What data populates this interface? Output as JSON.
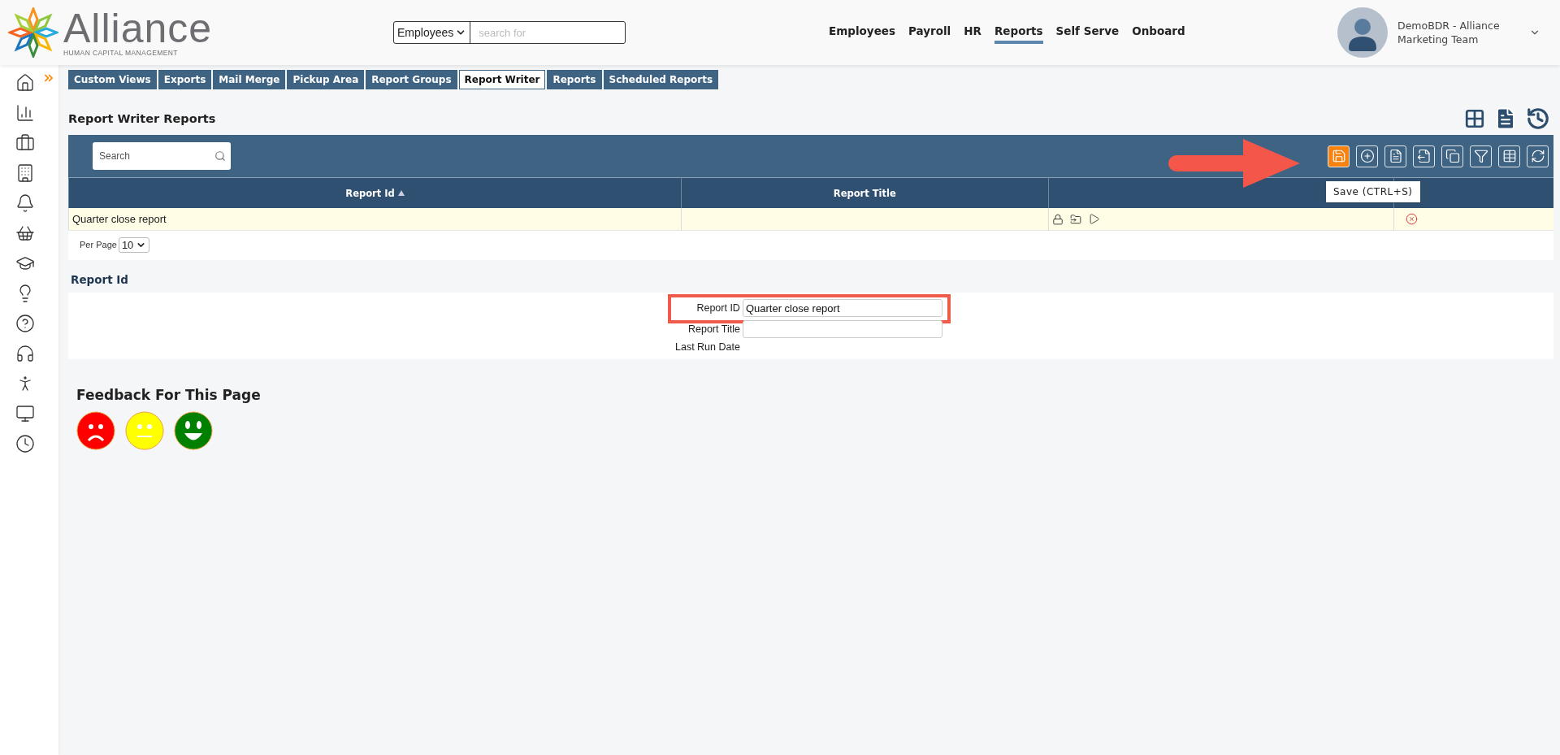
{
  "header": {
    "logo": {
      "name": "Alliance",
      "tagline": "HUMAN CAPITAL MANAGEMENT"
    },
    "search": {
      "scope": "Employees",
      "placeholder": "search for"
    },
    "nav": [
      {
        "label": "Employees",
        "selected": false
      },
      {
        "label": "Payroll",
        "selected": false
      },
      {
        "label": "HR",
        "selected": false
      },
      {
        "label": "Reports",
        "selected": true
      },
      {
        "label": "Self Serve",
        "selected": false
      },
      {
        "label": "Onboard",
        "selected": false
      }
    ],
    "user": {
      "name": "DemoBDR - Alliance Marketing Team"
    }
  },
  "sidebar": {
    "items": [
      {
        "kind": "home"
      },
      {
        "kind": "analytics"
      },
      {
        "kind": "briefcase"
      },
      {
        "kind": "building"
      },
      {
        "kind": "bell"
      },
      {
        "kind": "basket"
      },
      {
        "kind": "education"
      },
      {
        "kind": "idea"
      },
      {
        "kind": "help"
      },
      {
        "kind": "headphones"
      },
      {
        "kind": "person"
      },
      {
        "kind": "monitor"
      },
      {
        "kind": "clock"
      }
    ]
  },
  "tabs": [
    {
      "label": "Custom Views",
      "selected": false
    },
    {
      "label": "Exports",
      "selected": false
    },
    {
      "label": "Mail Merge",
      "selected": false
    },
    {
      "label": "Pickup Area",
      "selected": false
    },
    {
      "label": "Report Groups",
      "selected": false
    },
    {
      "label": "Report Writer",
      "selected": true
    },
    {
      "label": "Reports",
      "selected": false
    },
    {
      "label": "Scheduled Reports",
      "selected": false
    }
  ],
  "page_title": "Report Writer Reports",
  "toolbar": {
    "search_placeholder": "Search",
    "tooltip": "Save (CTRL+S)",
    "buttons": [
      {
        "kind": "save",
        "hovered": true
      },
      {
        "kind": "add",
        "hovered": false
      },
      {
        "kind": "document",
        "hovered": false
      },
      {
        "kind": "export",
        "hovered": false
      },
      {
        "kind": "copy",
        "hovered": false
      },
      {
        "kind": "filter",
        "hovered": false
      },
      {
        "kind": "grid",
        "hovered": false
      },
      {
        "kind": "refresh",
        "hovered": false
      }
    ]
  },
  "table": {
    "columns": [
      {
        "label": "Report Id",
        "sorted": true
      },
      {
        "label": "Report Title",
        "sorted": false
      }
    ],
    "rows": [
      {
        "report_id": "Quarter close report",
        "locked": true
      }
    ],
    "per_page": {
      "label": "Per Page",
      "value": "10"
    }
  },
  "form": {
    "title": "Report Id",
    "fields": [
      {
        "kind": "input",
        "label": "Report ID",
        "value": "Quarter close report",
        "highlighted": true
      },
      {
        "kind": "input",
        "label": "Report Title",
        "highlighted": false
      },
      {
        "kind": "text",
        "label": "Last Run Date",
        "highlighted": false
      }
    ]
  },
  "feedback": {
    "title": "Feedback For This Page",
    "faces": [
      {
        "kind": "sad",
        "color": "#ff0000"
      },
      {
        "kind": "neutral",
        "color": "#ffff00"
      },
      {
        "kind": "happy",
        "color": "#008000"
      }
    ]
  }
}
